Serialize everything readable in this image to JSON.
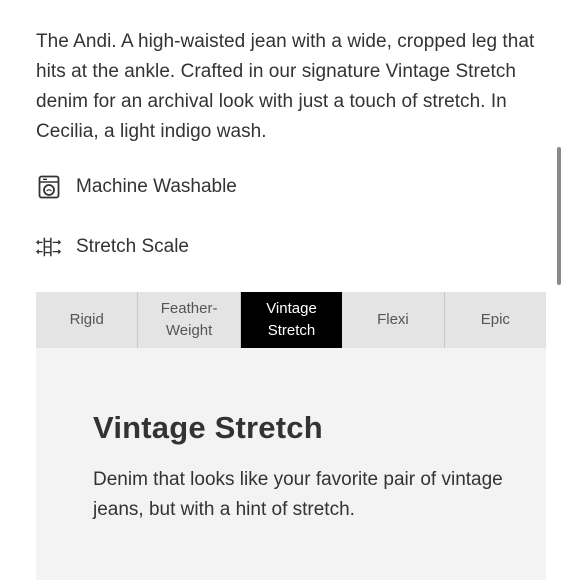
{
  "product": {
    "description": "The Andi. A high-waisted jean with a wide, cropped leg that hits at the ankle. Crafted in our signature Vintage Stretch denim for an archival look with just a touch of stretch. In Cecilia, a light indigo wash."
  },
  "features": [
    {
      "label": "Machine Washable",
      "icon": "washing-machine-icon"
    },
    {
      "label": "Stretch Scale",
      "icon": "stretch-scale-icon"
    }
  ],
  "stretch_scale": {
    "tabs": [
      {
        "label": "Rigid",
        "active": false
      },
      {
        "label": "Feather-\nWeight",
        "active": false
      },
      {
        "label": "Vintage\nStretch",
        "active": true
      },
      {
        "label": "Flexi",
        "active": false
      },
      {
        "label": "Epic",
        "active": false
      }
    ],
    "selected": {
      "title": "Vintage Stretch",
      "description": "Denim that looks like your favorite pair of vintage jeans, but with a hint of stretch."
    }
  },
  "colors": {
    "active_tab_bg": "#000000",
    "tab_bg": "#e4e4e4",
    "panel_bg": "#f3f3f3",
    "text": "#333333"
  }
}
